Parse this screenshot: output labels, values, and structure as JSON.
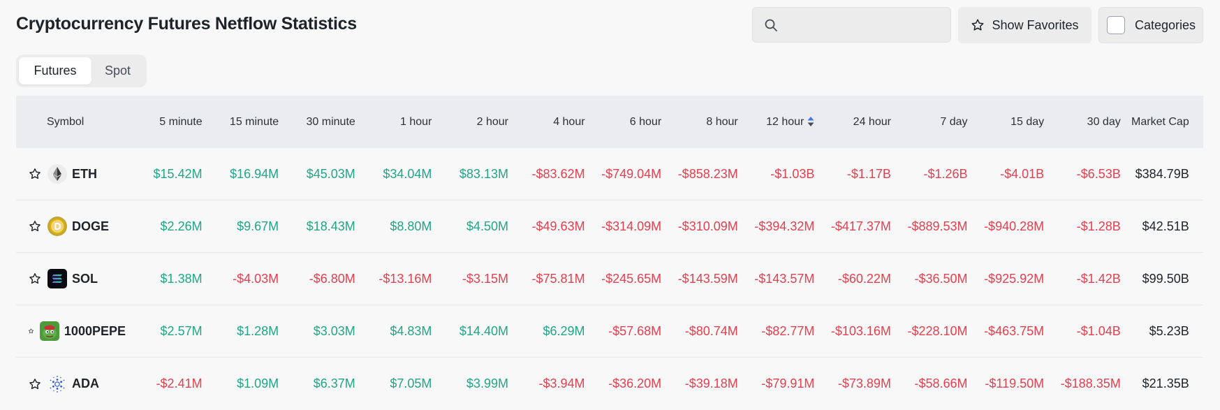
{
  "header": {
    "title": "Cryptocurrency Futures Netflow Statistics",
    "search": {
      "value": "",
      "placeholder": ""
    },
    "show_favorites_label": "Show Favorites",
    "categories_label": "Categories"
  },
  "tabs": [
    {
      "label": "Futures",
      "active": true
    },
    {
      "label": "Spot",
      "active": false
    }
  ],
  "table": {
    "columns": [
      "Symbol",
      "5 minute",
      "15 minute",
      "30 minute",
      "1 hour",
      "2 hour",
      "4 hour",
      "6 hour",
      "8 hour",
      "12 hour",
      "24 hour",
      "7 day",
      "15 day",
      "30 day",
      "Market Cap"
    ],
    "sorted_column": "12 hour",
    "rows": [
      {
        "symbol": "ETH",
        "icon": "eth-logo-icon",
        "values": [
          "$15.42M",
          "$16.94M",
          "$45.03M",
          "$34.04M",
          "$83.13M",
          "-$83.62M",
          "-$749.04M",
          "-$858.23M",
          "-$1.03B",
          "-$1.17B",
          "-$1.26B",
          "-$4.01B",
          "-$6.53B"
        ],
        "market_cap": "$384.79B"
      },
      {
        "symbol": "DOGE",
        "icon": "doge-logo-icon",
        "values": [
          "$2.26M",
          "$9.67M",
          "$18.43M",
          "$8.80M",
          "$4.50M",
          "-$49.63M",
          "-$314.09M",
          "-$310.09M",
          "-$394.32M",
          "-$417.37M",
          "-$889.53M",
          "-$940.28M",
          "-$1.28B"
        ],
        "market_cap": "$42.51B"
      },
      {
        "symbol": "SOL",
        "icon": "sol-logo-icon",
        "values": [
          "$1.38M",
          "-$4.03M",
          "-$6.80M",
          "-$13.16M",
          "-$3.15M",
          "-$75.81M",
          "-$245.65M",
          "-$143.59M",
          "-$143.57M",
          "-$60.22M",
          "-$36.50M",
          "-$925.92M",
          "-$1.42B"
        ],
        "market_cap": "$99.50B"
      },
      {
        "symbol": "1000PEPE",
        "icon": "pepe-logo-icon",
        "values": [
          "$2.57M",
          "$1.28M",
          "$3.03M",
          "$4.83M",
          "$14.40M",
          "$6.29M",
          "-$57.68M",
          "-$80.74M",
          "-$82.77M",
          "-$103.16M",
          "-$228.10M",
          "-$463.75M",
          "-$1.04B"
        ],
        "market_cap": "$5.23B"
      },
      {
        "symbol": "ADA",
        "icon": "ada-logo-icon",
        "values": [
          "-$2.41M",
          "$1.09M",
          "$6.37M",
          "$7.05M",
          "$3.99M",
          "-$3.94M",
          "-$36.20M",
          "-$39.18M",
          "-$79.91M",
          "-$73.89M",
          "-$58.66M",
          "-$119.50M",
          "-$188.35M"
        ],
        "market_cap": "$21.35B"
      }
    ]
  },
  "colors": {
    "positive": "#20a686",
    "negative": "#e5404f",
    "header_bg": "#eaecef",
    "page_bg": "#f8f8f8"
  }
}
